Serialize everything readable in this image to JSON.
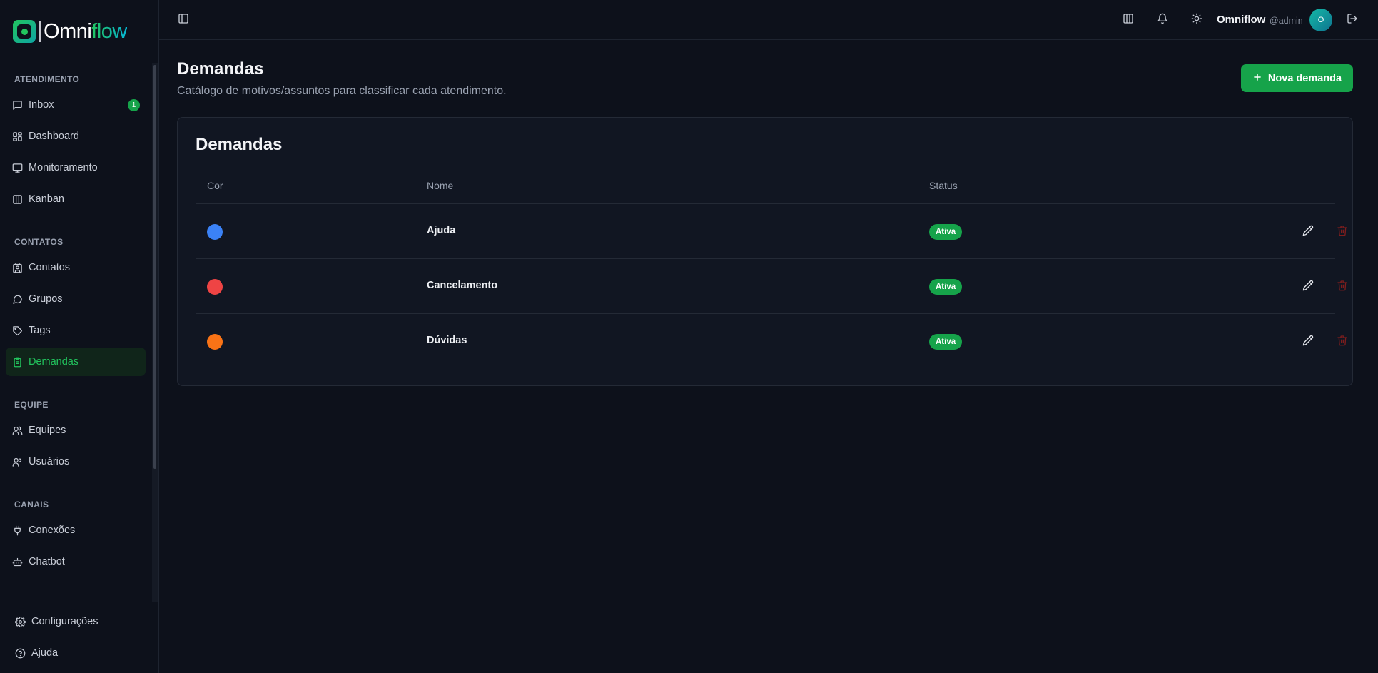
{
  "brand": {
    "name_part1": "Omni",
    "name_part2": "flow"
  },
  "sidebar": {
    "sections": [
      {
        "title": "ATENDIMENTO"
      },
      {
        "title": "CONTATOS"
      },
      {
        "title": "EQUIPE"
      },
      {
        "title": "CANAIS"
      }
    ],
    "items": {
      "inbox": {
        "label": "Inbox",
        "badge": "1"
      },
      "dashboard": {
        "label": "Dashboard"
      },
      "monitoramento": {
        "label": "Monitoramento"
      },
      "kanban": {
        "label": "Kanban"
      },
      "contatos": {
        "label": "Contatos"
      },
      "grupos": {
        "label": "Grupos"
      },
      "tags": {
        "label": "Tags"
      },
      "demandas": {
        "label": "Demandas"
      },
      "equipes": {
        "label": "Equipes"
      },
      "usuarios": {
        "label": "Usuários"
      },
      "conexoes": {
        "label": "Conexões"
      },
      "chatbot": {
        "label": "Chatbot"
      }
    },
    "bottom": {
      "configuracoes": {
        "label": "Configurações"
      },
      "ajuda": {
        "label": "Ajuda"
      }
    }
  },
  "header": {
    "user_name": "Omniflow",
    "user_handle": "@admin",
    "avatar_initial": "O",
    "icons": [
      "sidebar-toggle-icon",
      "columns-icon",
      "bell-icon",
      "sun-icon",
      "logout-icon"
    ]
  },
  "page": {
    "title": "Demandas",
    "subtitle": "Catálogo de motivos/assuntos para classificar cada atendimento.",
    "new_button": "Nova demanda"
  },
  "table": {
    "title": "Demandas",
    "columns": [
      "Cor",
      "Nome",
      "Status"
    ],
    "rows": [
      {
        "color": "#3b82f6",
        "name": "Ajuda",
        "status": "Ativa"
      },
      {
        "color": "#ef4444",
        "name": "Cancelamento",
        "status": "Ativa"
      },
      {
        "color": "#f97316",
        "name": "Dúvidas",
        "status": "Ativa"
      }
    ]
  },
  "colors": {
    "accent": "#16a34a",
    "danger": "#dc2626",
    "background": "#0d111b"
  }
}
